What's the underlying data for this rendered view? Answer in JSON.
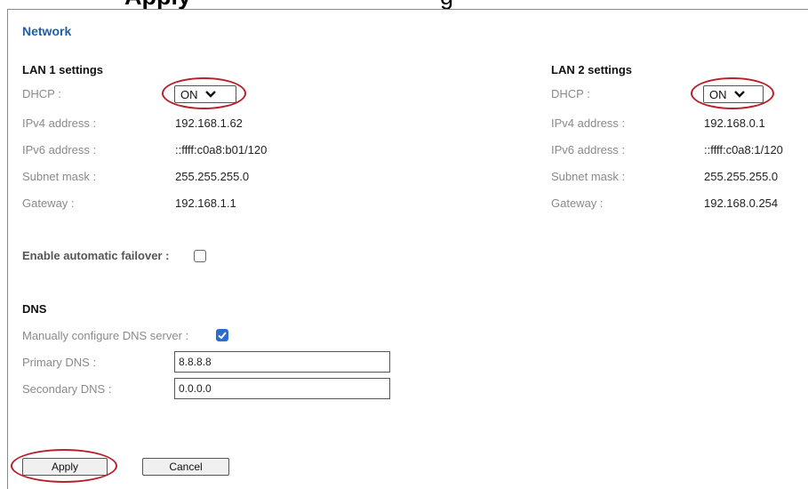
{
  "top_banner": {
    "bold": "Apply",
    "rest": "g"
  },
  "page": {
    "title": "Network"
  },
  "lan1": {
    "heading": "LAN 1 settings",
    "dhcp_label": "DHCP :",
    "dhcp_value": "ON",
    "ipv4_label": "IPv4 address :",
    "ipv4_value": "192.168.1.62",
    "ipv6_label": "IPv6 address :",
    "ipv6_value": "::ffff:c0a8:b01/120",
    "subnet_label": "Subnet mask :",
    "subnet_value": "255.255.255.0",
    "gateway_label": "Gateway :",
    "gateway_value": "192.168.1.1"
  },
  "lan2": {
    "heading": "LAN 2 settings",
    "dhcp_label": "DHCP :",
    "dhcp_value": "ON",
    "ipv4_label": "IPv4 address :",
    "ipv4_value": "192.168.0.1",
    "ipv6_label": "IPv6 address :",
    "ipv6_value": "::ffff:c0a8:1/120",
    "subnet_label": "Subnet mask :",
    "subnet_value": "255.255.255.0",
    "gateway_label": "Gateway :",
    "gateway_value": "192.168.0.254"
  },
  "failover": {
    "label": "Enable automatic failover :",
    "checked": false
  },
  "dns": {
    "heading": "DNS",
    "manual_label": "Manually configure DNS server :",
    "manual_checked": true,
    "primary_label": "Primary DNS :",
    "primary_value": "8.8.8.8",
    "secondary_label": "Secondary DNS :",
    "secondary_value": "0.0.0.0"
  },
  "actions": {
    "apply_label": "Apply",
    "cancel_label": "Cancel"
  },
  "colors": {
    "title": "#1f5fa8",
    "highlight_ring": "#b8202a",
    "checkbox_checked": "#2a6ccf"
  }
}
